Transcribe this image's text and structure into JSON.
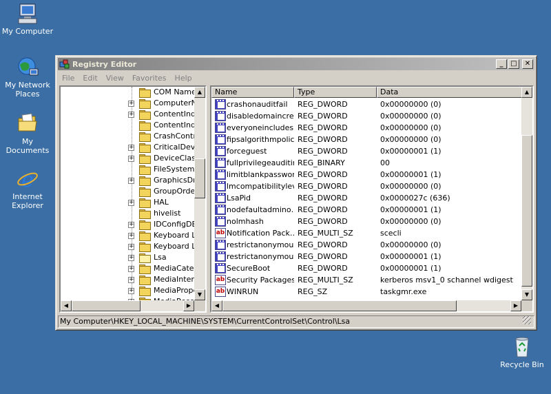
{
  "desktop": {
    "icons": [
      {
        "label": "My Computer"
      },
      {
        "label": "My Network Places"
      },
      {
        "label": "My Documents"
      },
      {
        "label": "Internet Explorer"
      },
      {
        "label": "Recycle Bin"
      }
    ]
  },
  "window": {
    "title": "Registry Editor",
    "controls": {
      "minimize": "_",
      "maximize": "□",
      "close": "✕"
    },
    "menu": [
      "File",
      "Edit",
      "View",
      "Favorites",
      "Help"
    ]
  },
  "tree": {
    "items": [
      {
        "label": "COM Name Arbiter",
        "expander": ""
      },
      {
        "label": "ComputerName",
        "expander": "+"
      },
      {
        "label": "ContentIndex",
        "expander": "+"
      },
      {
        "label": "ContentIndexCommon",
        "expander": ""
      },
      {
        "label": "CrashControl",
        "expander": ""
      },
      {
        "label": "CriticalDeviceDatabase",
        "expander": "+"
      },
      {
        "label": "DeviceClasses",
        "expander": "+"
      },
      {
        "label": "FileSystem",
        "expander": ""
      },
      {
        "label": "GraphicsDrivers",
        "expander": "+"
      },
      {
        "label": "GroupOrderList",
        "expander": ""
      },
      {
        "label": "HAL",
        "expander": "+"
      },
      {
        "label": "hivelist",
        "expander": ""
      },
      {
        "label": "IDConfigDB",
        "expander": "+"
      },
      {
        "label": "Keyboard Layout",
        "expander": "+"
      },
      {
        "label": "Keyboard Layouts",
        "expander": "+"
      },
      {
        "label": "Lsa",
        "expander": "+",
        "open": true
      },
      {
        "label": "MediaCategories",
        "expander": "+"
      },
      {
        "label": "MediaInterfaces",
        "expander": "+"
      },
      {
        "label": "MediaProperties",
        "expander": "+"
      },
      {
        "label": "MediaResources",
        "expander": "+"
      }
    ]
  },
  "list": {
    "columns": [
      "Name",
      "Type",
      "Data"
    ],
    "rows": [
      {
        "name": "crashonauditfail",
        "type": "REG_DWORD",
        "data": "0x00000000 (0)",
        "icon": "bin"
      },
      {
        "name": "disabledomaincreds",
        "type": "REG_DWORD",
        "data": "0x00000000 (0)",
        "icon": "bin"
      },
      {
        "name": "everyoneincludes…",
        "type": "REG_DWORD",
        "data": "0x00000000 (0)",
        "icon": "bin"
      },
      {
        "name": "fipsalgorithmpolicy",
        "type": "REG_DWORD",
        "data": "0x00000000 (0)",
        "icon": "bin"
      },
      {
        "name": "forceguest",
        "type": "REG_DWORD",
        "data": "0x00000001 (1)",
        "icon": "bin"
      },
      {
        "name": "fullprivilegeauditing",
        "type": "REG_BINARY",
        "data": "00",
        "icon": "bin"
      },
      {
        "name": "limitblankpasswor…",
        "type": "REG_DWORD",
        "data": "0x00000001 (1)",
        "icon": "bin"
      },
      {
        "name": "lmcompatibilitylevel",
        "type": "REG_DWORD",
        "data": "0x00000000 (0)",
        "icon": "bin"
      },
      {
        "name": "LsaPid",
        "type": "REG_DWORD",
        "data": "0x0000027c (636)",
        "icon": "bin"
      },
      {
        "name": "nodefaultadmino…",
        "type": "REG_DWORD",
        "data": "0x00000001 (1)",
        "icon": "bin"
      },
      {
        "name": "nolmhash",
        "type": "REG_DWORD",
        "data": "0x00000000 (0)",
        "icon": "bin"
      },
      {
        "name": "Notification Pack…",
        "type": "REG_MULTI_SZ",
        "data": "scecli",
        "icon": "sz"
      },
      {
        "name": "restrictanonymous",
        "type": "REG_DWORD",
        "data": "0x00000000 (0)",
        "icon": "bin"
      },
      {
        "name": "restrictanonymou…",
        "type": "REG_DWORD",
        "data": "0x00000001 (1)",
        "icon": "bin"
      },
      {
        "name": "SecureBoot",
        "type": "REG_DWORD",
        "data": "0x00000001 (1)",
        "icon": "bin"
      },
      {
        "name": "Security Packages",
        "type": "REG_MULTI_SZ",
        "data": "kerberos msv1_0 schannel wdigest",
        "icon": "sz"
      },
      {
        "name": "WINRUN",
        "type": "REG_SZ",
        "data": "taskgmr.exe",
        "icon": "sz"
      }
    ]
  },
  "status": {
    "path": "My Computer\\HKEY_LOCAL_MACHINE\\SYSTEM\\CurrentControlSet\\Control\\Lsa"
  }
}
